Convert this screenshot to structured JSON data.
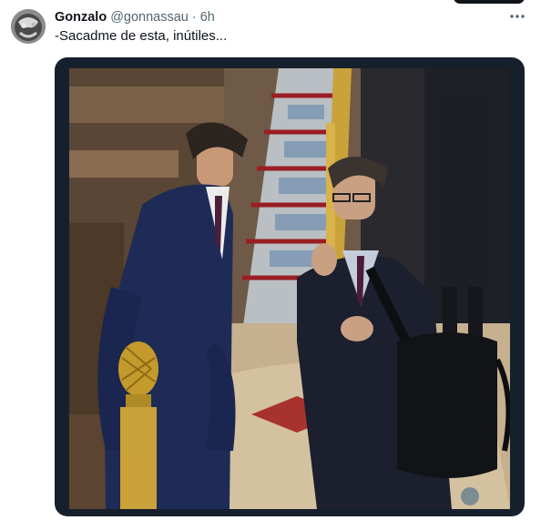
{
  "tweet": {
    "author_name": "Gonzalo",
    "author_handle": "@gonnassau",
    "separator": "·",
    "time": "6h",
    "text": "-Sacadme de esta, inútiles...",
    "more_icon": "more-horizontal-icon"
  },
  "colors": {
    "primary_text": "#0f1419",
    "secondary_text": "#536471",
    "media_frame": "#16202c"
  }
}
